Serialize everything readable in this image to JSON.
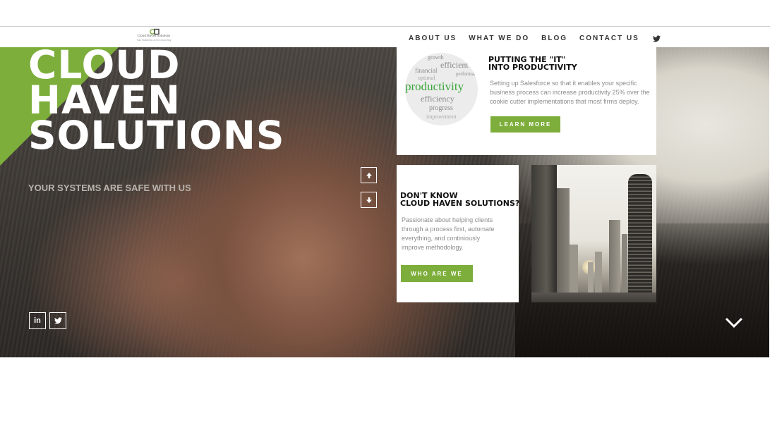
{
  "brand": {
    "logo_name": "Cloud Haven Solutions",
    "logo_tagline": "Your Business on the cloud Sky"
  },
  "nav": {
    "items": [
      "ABOUT US",
      "WHAT WE DO",
      "BLOG",
      "CONTACT US"
    ],
    "twitter_icon": "twitter-icon"
  },
  "hero": {
    "title_lines": [
      "CLOUD",
      "HAVEN",
      "SOLUTIONS"
    ],
    "subtitle": "YOUR SYSTEMS ARE SAFE WITH US",
    "arrow_up_icon": "arrow-up-icon",
    "arrow_down_icon": "arrow-down-icon",
    "social": [
      "in",
      "twitter"
    ],
    "scroll_icon": "chevron-down-icon",
    "accent_color": "#7dae3b"
  },
  "card_productivity": {
    "heading_lines": [
      "PUTTING THE \"IT\"",
      "INTO PRODUCTIVITY"
    ],
    "text_lines": [
      "Setting up Salesforce so that it enables your specific",
      "business process can increase productivity 25% over the",
      "cookie cutter implementations that most firms deploy."
    ],
    "button": "LEARN MORE",
    "wordcloud": [
      "productivity",
      "efficiency",
      "progress",
      "financial",
      "performance",
      "efficient",
      "growth",
      "improvement",
      "optimal"
    ]
  },
  "card_about": {
    "heading_lines": [
      "DON'T KNOW",
      "CLOUD HAVEN SOLUTIONS?"
    ],
    "text_lines": [
      "Passionate about helping clients",
      "through a process first, automate",
      "everything, and continiously",
      "improve methodology."
    ],
    "button": "WHO ARE WE"
  }
}
